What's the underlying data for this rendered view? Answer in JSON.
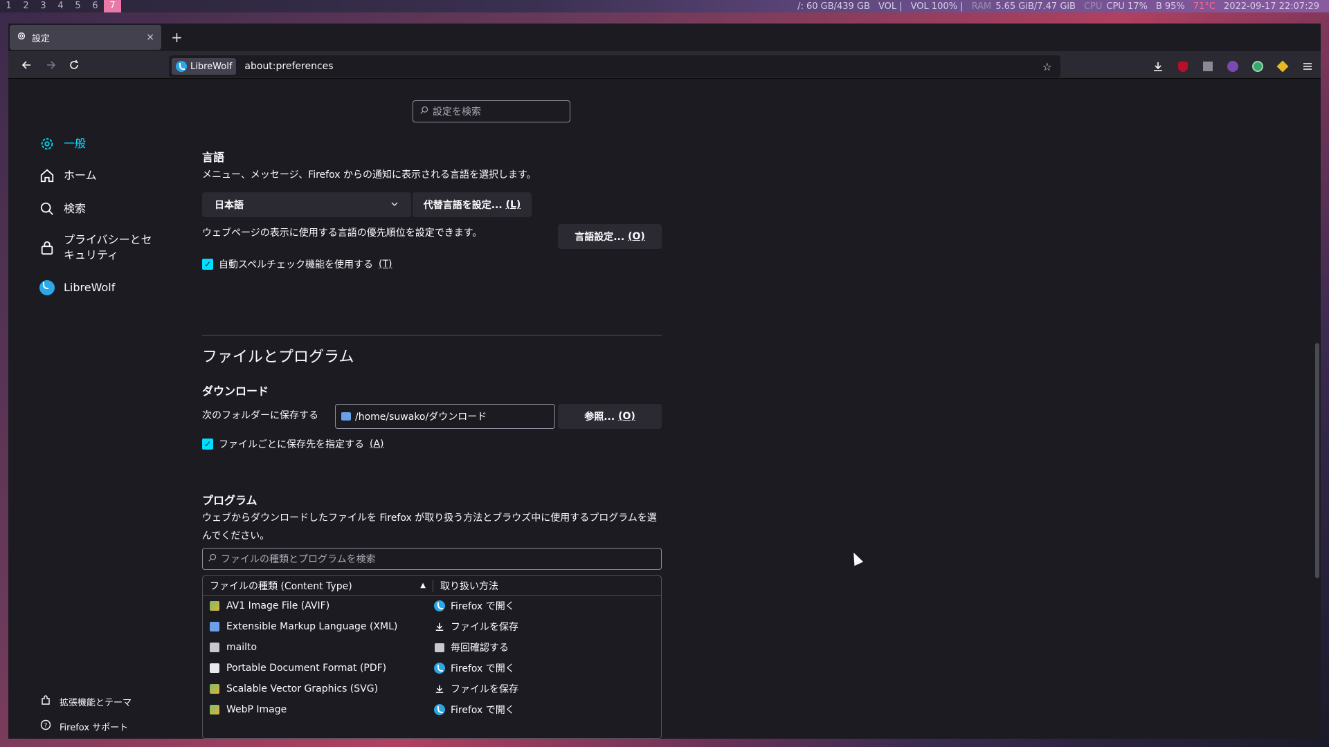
{
  "statusbar": {
    "workspaces": [
      "1",
      "2",
      "3",
      "4",
      "5",
      "6",
      "7"
    ],
    "active_workspace": "7",
    "disk": "/: 60 GB/439 GB",
    "vol1": "VOL |",
    "vol2": "VOL 100% |",
    "ram_label": "RAM",
    "ram": "5.65 GiB/7.47 GiB",
    "cpu_label": "CPU",
    "cpu": "CPU 17%",
    "bat": "B 95%",
    "temp": "71°C",
    "datetime": "2022-09-17 22:07:29"
  },
  "tab": {
    "title": "設定",
    "close": "×",
    "new_tab": "+"
  },
  "nav": {
    "identity_label": "LibreWolf",
    "url": "about:preferences"
  },
  "sidebar": {
    "items": [
      {
        "label": "一般",
        "icon": "gear-icon"
      },
      {
        "label": "ホーム",
        "icon": "home-icon"
      },
      {
        "label": "検索",
        "icon": "search-icon"
      },
      {
        "label": "プライバシーとセキュリティ",
        "icon": "lock-icon"
      },
      {
        "label": "LibreWolf",
        "icon": "librewolf-icon"
      }
    ],
    "footer": [
      {
        "label": "拡張機能とテーマ",
        "icon": "puzzle-icon"
      },
      {
        "label": "Firefox サポート",
        "icon": "help-icon"
      }
    ]
  },
  "search": {
    "placeholder": "設定を検索"
  },
  "language": {
    "heading": "言語",
    "description": "メニュー、メッセージ、Firefox からの通知に表示される言語を選択します。",
    "selected": "日本語",
    "alt_button": "代替言語を設定...",
    "alt_key": "(L)",
    "web_desc": "ウェブページの表示に使用する言語の優先順位を設定できます。",
    "settings_button": "言語設定...",
    "settings_key": "(O)",
    "spellcheck": "自動スペルチェック機能を使用する",
    "spellcheck_key": "(T)"
  },
  "files": {
    "heading": "ファイルとプログラム",
    "download_heading": "ダウンロード",
    "save_to": "次のフォルダーに保存する",
    "folder": "/home/suwako/ダウンロード",
    "browse_button": "参照...",
    "browse_key": "(O)",
    "ask_each": "ファイルごとに保存先を指定する",
    "ask_key": "(A)"
  },
  "programs": {
    "heading": "プログラム",
    "description": "ウェブからダウンロードしたファイルを Firefox が取り扱う方法とブラウズ中に使用するプログラムを選んでください。",
    "filter_placeholder": "ファイルの種類とプログラムを検索",
    "col_type": "ファイルの種類 (Content Type)",
    "col_action": "取り扱い方法",
    "rows": [
      {
        "type": "AV1 Image File (AVIF)",
        "action": "Firefox で開く",
        "ficon": "img",
        "aicon": "lw"
      },
      {
        "type": "Extensible Markup Language (XML)",
        "action": "ファイルを保存",
        "ficon": "xml",
        "aicon": "dl"
      },
      {
        "type": "mailto",
        "action": "毎回確認する",
        "ficon": "ask",
        "aicon": "ask"
      },
      {
        "type": "Portable Document Format (PDF)",
        "action": "Firefox で開く",
        "ficon": "doc",
        "aicon": "lw"
      },
      {
        "type": "Scalable Vector Graphics (SVG)",
        "action": "ファイルを保存",
        "ficon": "img",
        "aicon": "dl"
      },
      {
        "type": "WebP Image",
        "action": "Firefox で開く",
        "ficon": "img",
        "aicon": "lw"
      }
    ]
  },
  "colors": {
    "accent": "#00ddff",
    "bg": "#1c1b22",
    "panel": "#2b2a33"
  }
}
